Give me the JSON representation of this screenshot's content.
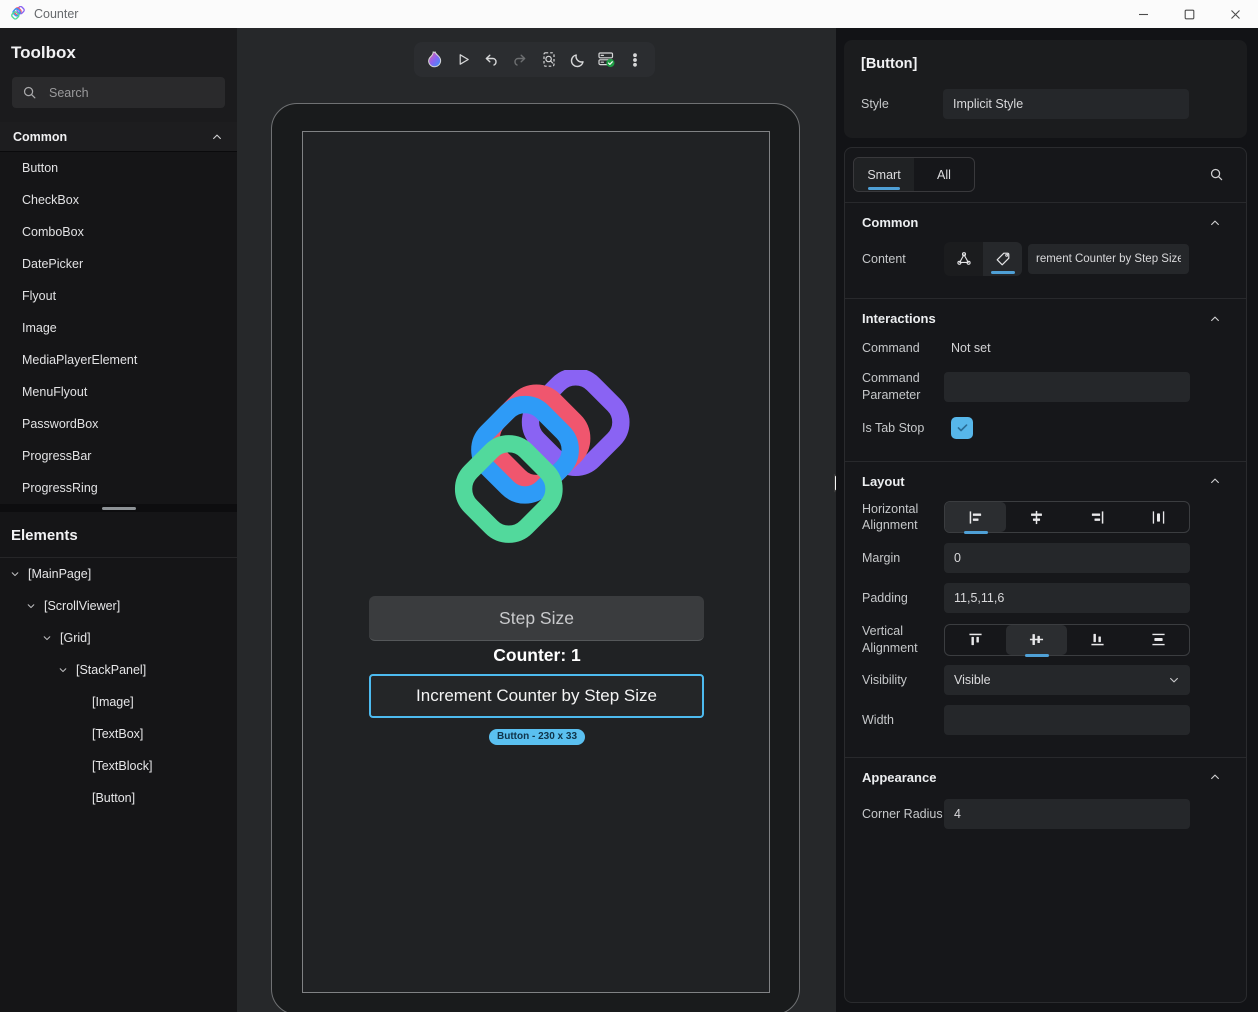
{
  "window": {
    "title": "Counter",
    "controls": [
      "minimize",
      "maximize",
      "close"
    ]
  },
  "toolbox": {
    "title": "Toolbox",
    "search_placeholder": "Search",
    "section_title": "Common",
    "items": [
      "Button",
      "CheckBox",
      "ComboBox",
      "DatePicker",
      "Flyout",
      "Image",
      "MediaPlayerElement",
      "MenuFlyout",
      "PasswordBox",
      "ProgressBar",
      "ProgressRing"
    ]
  },
  "elements": {
    "title": "Elements",
    "tree": [
      {
        "label": "[MainPage]",
        "level": 0,
        "expandable": true
      },
      {
        "label": "[ScrollViewer]",
        "level": 1,
        "expandable": true
      },
      {
        "label": "[Grid]",
        "level": 2,
        "expandable": true
      },
      {
        "label": "[StackPanel]",
        "level": 3,
        "expandable": true
      },
      {
        "label": "[Image]",
        "level": 4,
        "expandable": false
      },
      {
        "label": "[TextBox]",
        "level": 4,
        "expandable": false
      },
      {
        "label": "[TextBlock]",
        "level": 4,
        "expandable": false
      },
      {
        "label": "[Button]",
        "level": 4,
        "expandable": false
      }
    ]
  },
  "toolbar_icons": [
    "hot-reload-flame",
    "play",
    "undo",
    "redo",
    "zoom-selection",
    "dark-mode-moon",
    "connection-status-ok",
    "more-options"
  ],
  "canvas": {
    "textbox_text": "Step Size",
    "counter_text": "Counter: 1",
    "button_label": "Increment Counter by Step Size",
    "selection_badge": "Button - 230 x 33"
  },
  "inspector": {
    "header": {
      "title": "[Button]",
      "style_label": "Style",
      "style_value": "Implicit Style"
    },
    "tabs": {
      "smart": "Smart",
      "all": "All",
      "selected": "Smart"
    },
    "sections": {
      "common": {
        "title": "Common",
        "content_label": "Content",
        "content_value": "rement Counter by Step Size",
        "content_mode": "text"
      },
      "interactions": {
        "title": "Interactions",
        "command_label": "Command",
        "command_value": "Not set",
        "command_parameter_label": "Command Parameter",
        "command_parameter_value": "",
        "is_tab_stop_label": "Is Tab Stop",
        "is_tab_stop_checked": true
      },
      "layout": {
        "title": "Layout",
        "horizontal_alignment_label": "Horizontal Alignment",
        "horizontal_alignment": "left",
        "margin_label": "Margin",
        "margin_value": "0",
        "padding_label": "Padding",
        "padding_value": "11,5,11,6",
        "vertical_alignment_label": "Vertical Alignment",
        "vertical_alignment": "center",
        "visibility_label": "Visibility",
        "visibility_value": "Visible",
        "width_label": "Width",
        "width_value": ""
      },
      "appearance": {
        "title": "Appearance",
        "corner_radius_label": "Corner Radius",
        "corner_radius_value": "4"
      }
    }
  },
  "colors": {
    "accent_underline": "#4fa0d6",
    "accent_bright": "#57bdf0",
    "selection_border": "#4dbbf0",
    "badge_bg": "#5ac0f0"
  }
}
